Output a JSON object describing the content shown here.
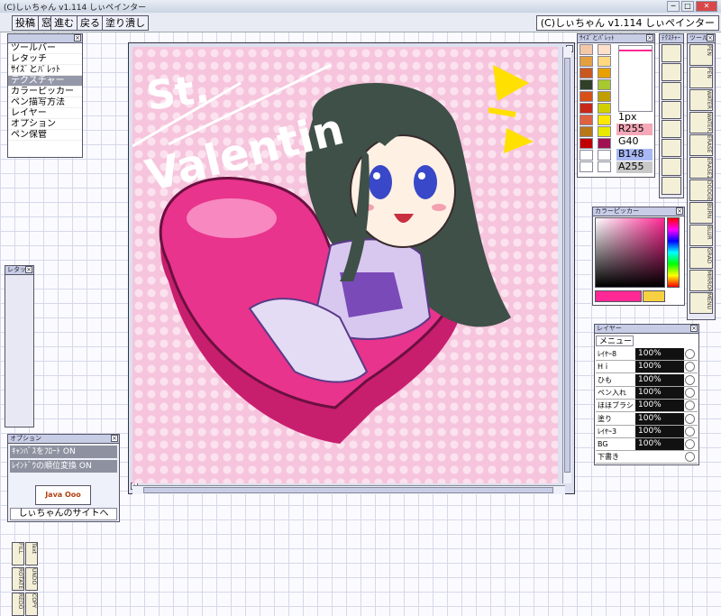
{
  "window": {
    "title": "(C)しぃちゃん v1.114 しぃペインター",
    "min": "─",
    "max": "□",
    "close": "✕"
  },
  "menu": {
    "items": [
      "投稿",
      "窓",
      "進む",
      "戻る",
      "塗り潰し"
    ],
    "app_title": "(C)しぃちゃん v1.114 しぃペインター"
  },
  "window_panel": {
    "items": [
      "ツールバー",
      "レタッチ",
      "ｻｲｽﾞとﾊﾟﾚｯﾄ",
      "テクスチャー",
      "カラーピッカー",
      "ペン描写方法",
      "レイヤー",
      "オプション",
      "ペン保管"
    ],
    "selected": 3
  },
  "retouch": {
    "title": "レタッチ",
    "tools": [
      "FILL",
      "Text",
      "ROTATE",
      "UNDO",
      "REDO",
      "COPY"
    ]
  },
  "option": {
    "title": "オプション",
    "rows": [
      "ｷｬﾝﾊﾞｽをﾌﾛｰﾄ ON",
      "ﾚｲﾝﾄﾞｳの順位変換 ON"
    ],
    "logo_text": "Java Ooo",
    "link": "しぃちゃんのサイトへ"
  },
  "palette": {
    "title": "ｻｲｽﾞとﾊﾟﾚｯﾄ",
    "size": "1px",
    "r": "R255",
    "g": "G40",
    "b": "B148",
    "a": "A255",
    "swatches": [
      "#f3c8a8",
      "#ffe0c8",
      "#e2a040",
      "#ffd880",
      "#c85820",
      "#e8a000",
      "#304028",
      "#a8c830",
      "#d85018",
      "#c0a000",
      "#c82818",
      "#d0d000",
      "#e06040",
      "#ffe800",
      "#b87818",
      "#e8e800",
      "#c00000",
      "#a01050",
      "#ffffff",
      "#ffffff",
      "#ffffff",
      "#ffffff"
    ],
    "main_color": "#ff2894"
  },
  "texture": {
    "title": "ﾃｸｽﾁｬｰ"
  },
  "toolbar": {
    "title": "ツール",
    "tools": [
      "PEN",
      "PEN",
      "WATER",
      "WATER2",
      "ERASE",
      "ERASE2",
      "DODGE",
      "BURN",
      "BLUR",
      "GRAD",
      "MIRROR",
      "MENU"
    ]
  },
  "color_picker": {
    "title": "カラーピッカー",
    "current": "#ff2894",
    "secondary": "#f6d040"
  },
  "layers": {
    "title": "レイヤー",
    "menu": "メニュー",
    "rows": [
      {
        "name": "ﾚｲﾔｰ8",
        "val": "100%"
      },
      {
        "name": "Hｉ",
        "val": "100%"
      },
      {
        "name": "ひも",
        "val": "100%"
      },
      {
        "name": "ペン入れ",
        "val": "100%"
      },
      {
        "name": "ほほブラシ",
        "val": "100%"
      },
      {
        "name": "塗り",
        "val": "100%"
      },
      {
        "name": "ﾚｲﾔｰ3",
        "val": "100%"
      },
      {
        "name": "BG",
        "val": "100%"
      },
      {
        "name": "下書き",
        "val": ""
      }
    ]
  },
  "artwork": {
    "line1": "St.",
    "line2": "Valentin",
    "bg": "#f6c4dc",
    "heart": "#e8348c"
  }
}
